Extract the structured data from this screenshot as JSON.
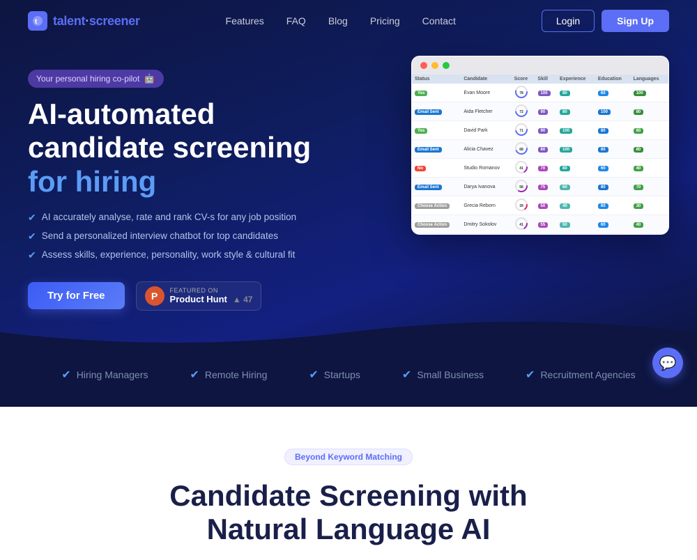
{
  "brand": {
    "name_prefix": "talent",
    "name_suffix": "screener",
    "icon_char": "t"
  },
  "nav": {
    "links": [
      "Features",
      "FAQ",
      "Blog",
      "Pricing",
      "Contact"
    ],
    "login_label": "Login",
    "signup_label": "Sign Up"
  },
  "hero": {
    "badge_text": "Your personal hiring co-pilot",
    "badge_emoji": "🤖",
    "title_line1": "AI-automated",
    "title_line2": "candidate screening",
    "title_line3": "for hiring",
    "features": [
      "AI accurately analyse, rate and rank CV-s for any job position",
      "Send a personalized interview chatbot for top candidates",
      "Assess skills, experience, personality, work style &  cultural fit"
    ],
    "cta_button": "Try for Free",
    "product_hunt": {
      "label": "FEATURED ON",
      "name": "Product Hunt",
      "score": "47"
    }
  },
  "social_proof": {
    "items": [
      "Hiring Managers",
      "Remote Hiring",
      "Startups",
      "Small Business",
      "Recruitment Agencies"
    ]
  },
  "section": {
    "tag": "Beyond Keyword Matching",
    "title_line1": "Candidate Screening with",
    "title_line2": "Natural Language AI"
  },
  "screenshot": {
    "columns": [
      "Status",
      "Candidate",
      "Score",
      "Skill",
      "Experience",
      "Education",
      "Languages"
    ],
    "rows": [
      {
        "status": "Yes",
        "name": "Evan Moore",
        "score": 78,
        "skill": "100",
        "exp": "80",
        "edu": "60",
        "lang": "100"
      },
      {
        "status": "Email Sent",
        "name": "Aida Fletcher",
        "score": 72,
        "skill": "90",
        "exp": "80",
        "edu": "100",
        "lang": "80"
      },
      {
        "status": "Yes",
        "name": "David Park",
        "score": 71,
        "skill": "90",
        "exp": "100",
        "edu": "80",
        "lang": "60"
      },
      {
        "status": "Email Sent",
        "name": "Alicia Chavez",
        "score": 68,
        "skill": "80",
        "exp": "100",
        "edu": "80",
        "lang": "80"
      },
      {
        "status": "No",
        "name": "Studio Romanov",
        "score": 41,
        "skill": "70",
        "exp": "80",
        "edu": "60",
        "lang": "40"
      },
      {
        "status": "Email Sent",
        "name": "Darya Ivanova",
        "score": 58,
        "skill": "75",
        "exp": "60",
        "edu": "80",
        "lang": "70"
      },
      {
        "status": "Choose Action",
        "name": "Grecia Reborn",
        "score": 39,
        "skill": "50",
        "exp": "40",
        "edu": "60",
        "lang": "30"
      },
      {
        "status": "Choose Action",
        "name": "Dmitry Sokolov",
        "score": 41,
        "skill": "55",
        "exp": "50",
        "edu": "60",
        "lang": "40"
      }
    ]
  }
}
